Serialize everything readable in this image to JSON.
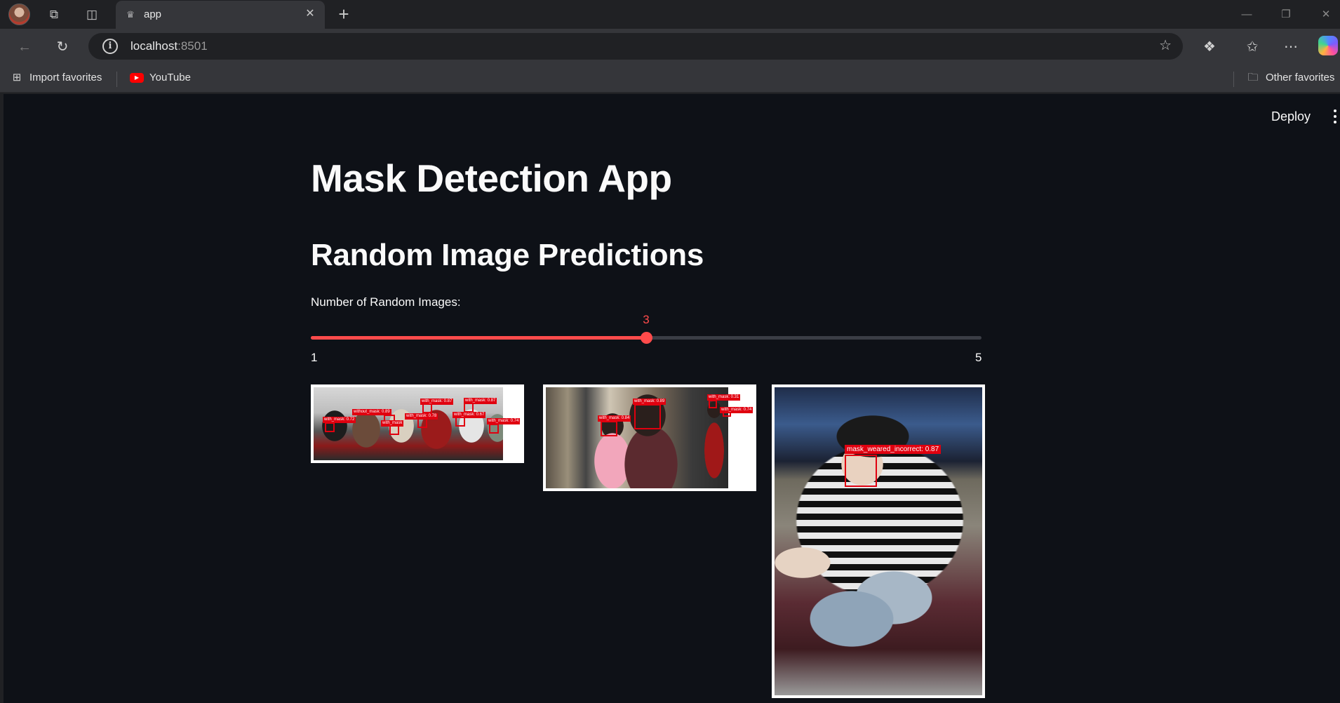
{
  "browser": {
    "tab": {
      "title": "app"
    },
    "address": {
      "host": "localhost",
      "port": ":8501"
    },
    "bookmarks": [
      {
        "label": "Import favorites",
        "icon": "import-favorites-icon"
      },
      {
        "label": "YouTube",
        "icon": "youtube-icon"
      }
    ],
    "other_favorites": "Other favorites"
  },
  "app": {
    "deploy_label": "Deploy",
    "title": "Mask Detection App",
    "subtitle": "Random Image Predictions",
    "slider": {
      "label": "Number of Random Images:",
      "value": "3",
      "min": "1",
      "max": "5",
      "fraction": 0.5,
      "accent": "#ff4b4b"
    },
    "images": [
      {
        "detections": [
          "without_mask: 0.89",
          "with_mask: 0.87",
          "with_mask: 0.87",
          "with_mask: 0.72",
          "with_mask: 0.78",
          "with_mask: 0.67",
          "with_mask: 0.74",
          "with_mask"
        ]
      },
      {
        "detections": [
          "with_mask: 0.89",
          "with_mask: 0.84",
          "with_mask: 0.31",
          "with_mask: 0.74"
        ]
      },
      {
        "detections": [
          "mask_weared_incorrect: 0.87"
        ]
      }
    ]
  },
  "colors": {
    "background": "#0e1117",
    "text": "#fafafa",
    "detection_box": "#e0000f"
  }
}
